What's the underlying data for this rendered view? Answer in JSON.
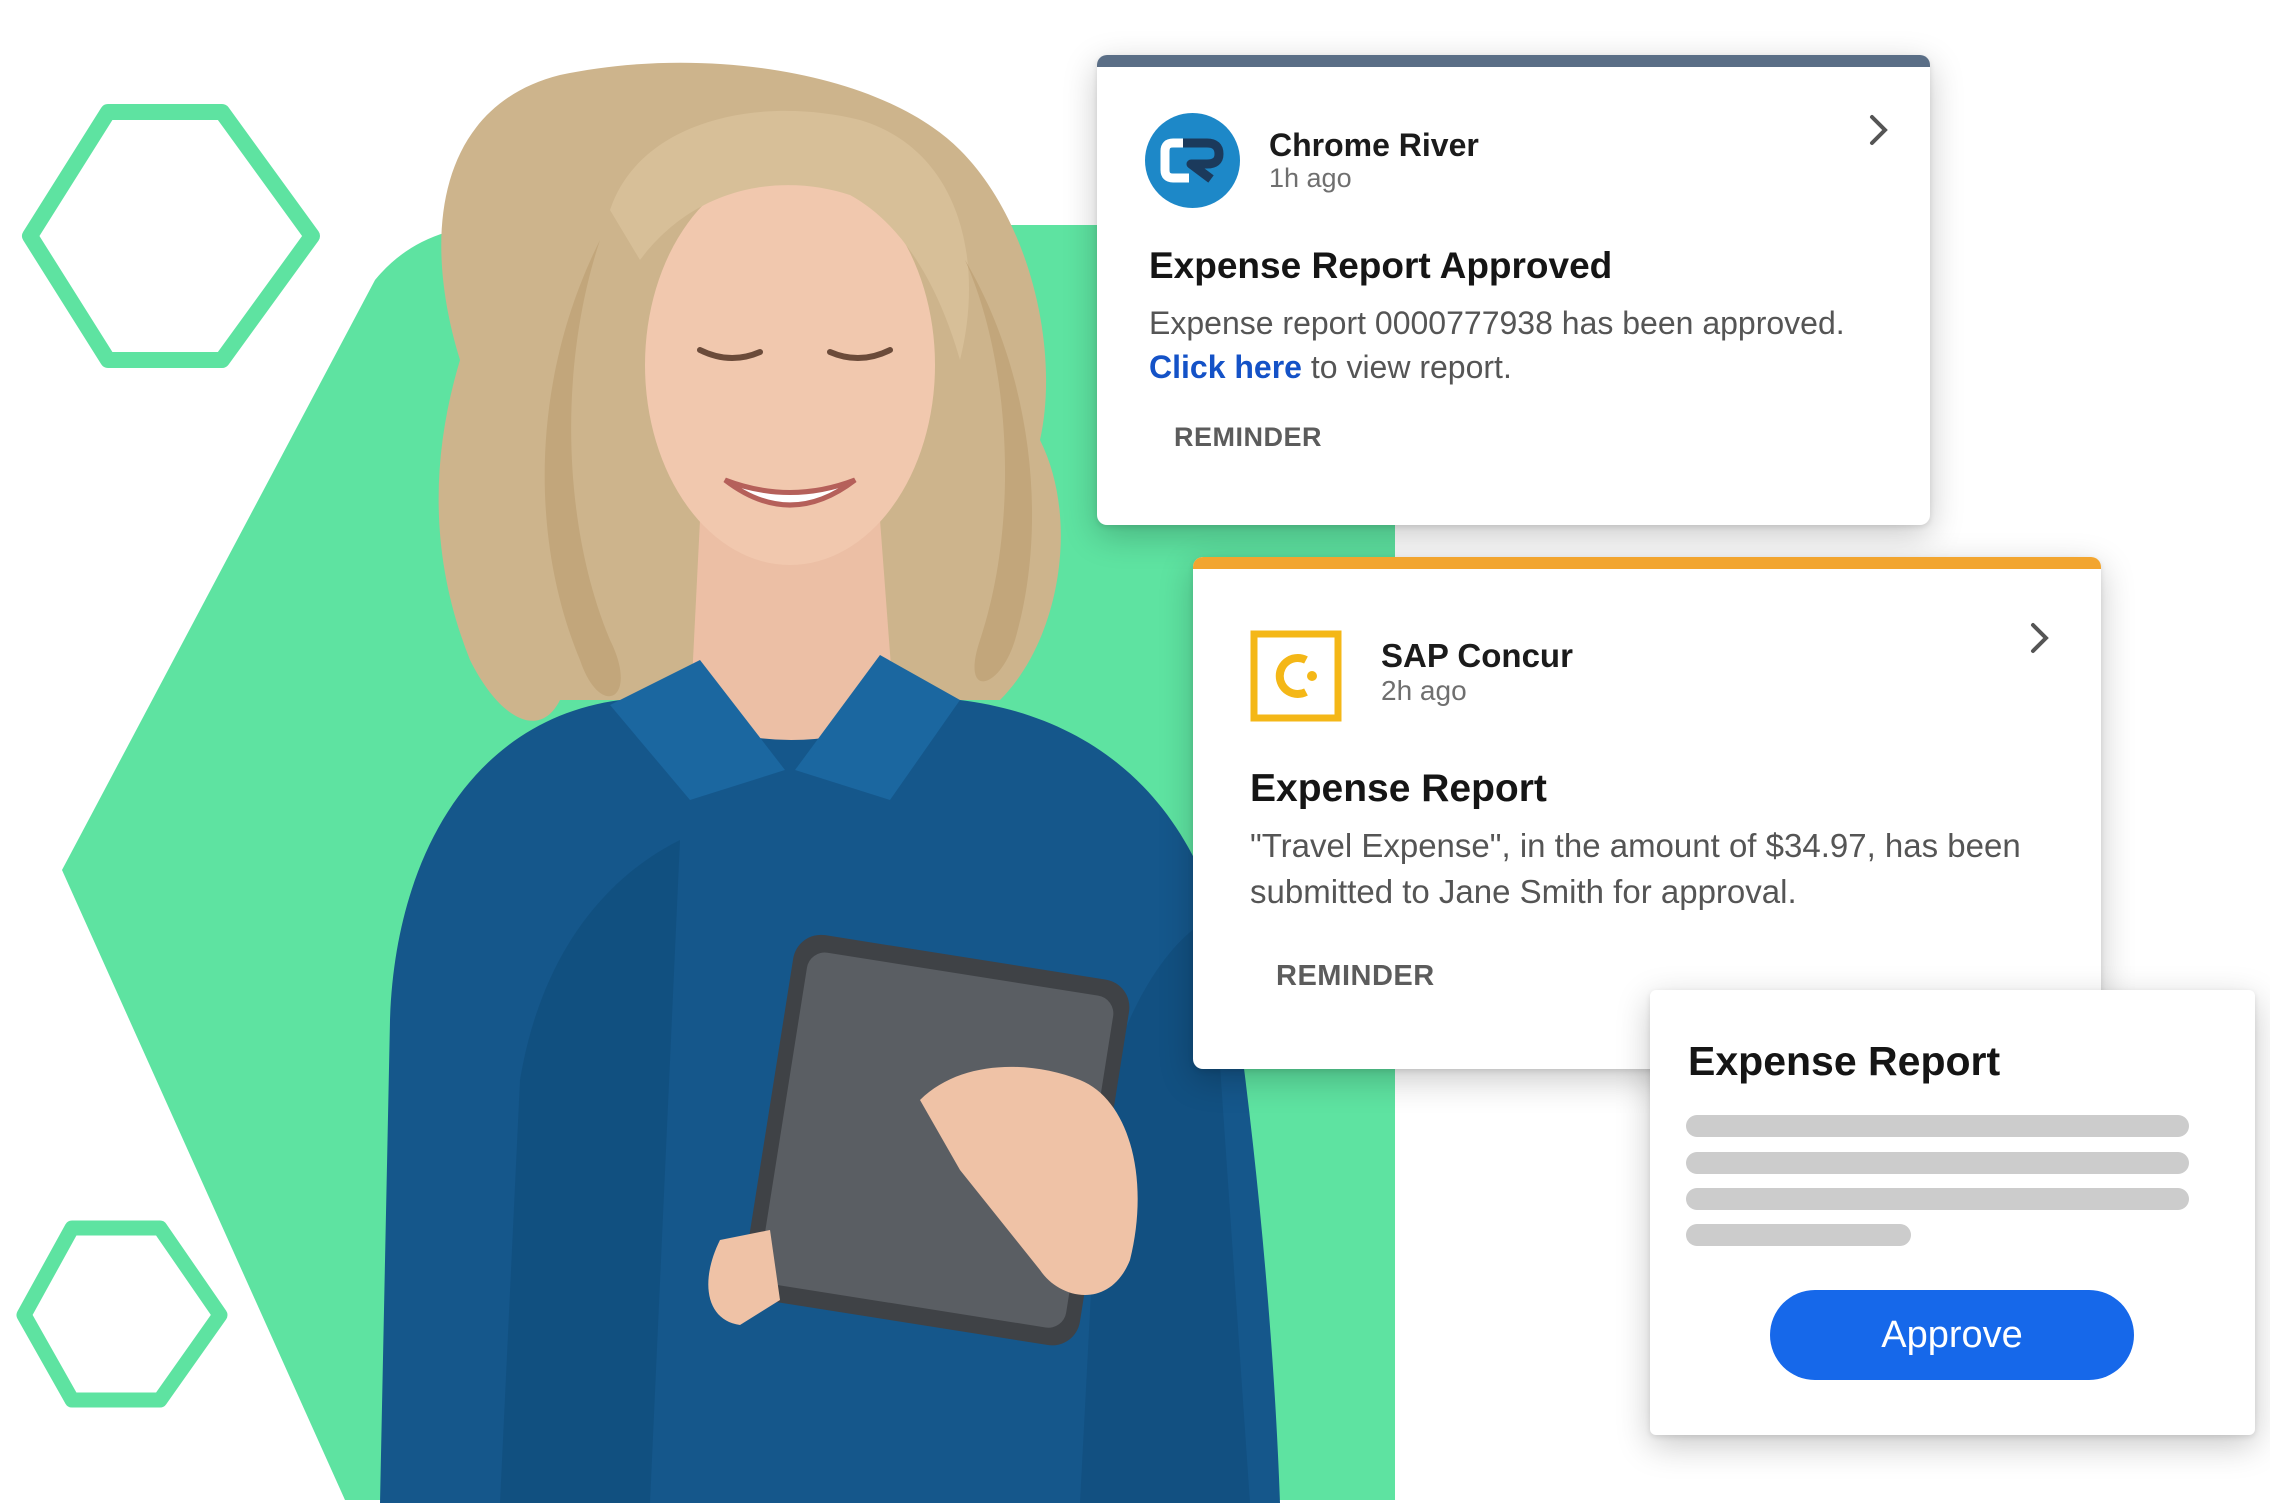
{
  "notifications": [
    {
      "app_name": "Chrome River",
      "time_ago": "1h ago",
      "icon": "chrome-river-logo",
      "accent_color": "#5a6e86",
      "title": "Expense Report Approved",
      "message": "Expense report 0000777938 has been approved.",
      "link_text": "Click here",
      "link_suffix": " to view report.",
      "action_label": "REMINDER"
    },
    {
      "app_name": "SAP Concur",
      "time_ago": "2h ago",
      "icon": "sap-concur-logo",
      "accent_color": "#f2a52f",
      "title": "Expense Report",
      "message": "\"Travel Expense\", in the amount of $34.97, has been submitted to Jane Smith for approval.",
      "action_label": "REMINDER"
    }
  ],
  "approval_card": {
    "title": "Expense Report",
    "button_label": "Approve",
    "button_color": "#1668ea"
  },
  "decor": {
    "hexagon_color": "#5ee3a1",
    "photo": "smiling woman with blonde hair in blue blouse holding a tablet"
  }
}
